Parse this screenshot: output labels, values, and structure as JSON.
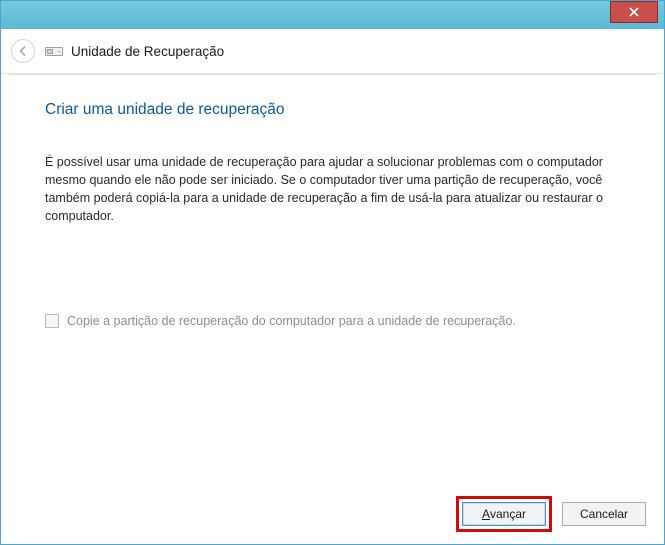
{
  "titlebar": {
    "close_icon": "close"
  },
  "header": {
    "back_icon": "back-arrow",
    "drive_icon": "drive",
    "title": "Unidade de Recuperação"
  },
  "page": {
    "title": "Criar uma unidade de recuperação",
    "body": "É possível usar uma unidade de recuperação para ajudar a solucionar problemas com o computador mesmo quando ele não pode ser iniciado. Se o computador tiver uma partição de recuperação, você também poderá copiá-la para a unidade de recuperação a fim de usá-la para atualizar ou restaurar o computador."
  },
  "checkbox": {
    "checked": false,
    "enabled": false,
    "label": "Copie a partição de recuperação do computador para a unidade de recuperação."
  },
  "footer": {
    "next_prefix": "A",
    "next_rest": "vançar",
    "cancel": "Cancelar"
  },
  "colors": {
    "accent": "#5bb9d6",
    "link_title": "#0a5a9c",
    "highlight": "#d20a0a"
  }
}
